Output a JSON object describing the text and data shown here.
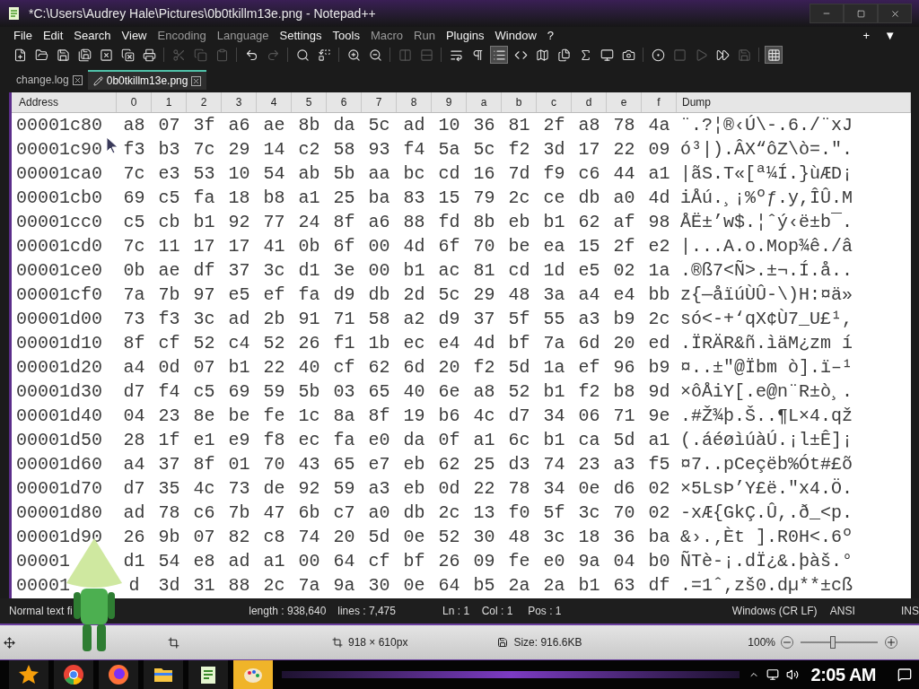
{
  "window": {
    "title": "*C:\\Users\\Audrey Hale\\Pictures\\0b0tkillm13e.png - Notepad++"
  },
  "menu": [
    {
      "label": "File",
      "disabled": false
    },
    {
      "label": "Edit",
      "disabled": false
    },
    {
      "label": "Search",
      "disabled": false
    },
    {
      "label": "View",
      "disabled": false
    },
    {
      "label": "Encoding",
      "disabled": true
    },
    {
      "label": "Language",
      "disabled": true
    },
    {
      "label": "Settings",
      "disabled": false
    },
    {
      "label": "Tools",
      "disabled": false
    },
    {
      "label": "Macro",
      "disabled": true
    },
    {
      "label": "Run",
      "disabled": true
    },
    {
      "label": "Plugins",
      "disabled": false
    },
    {
      "label": "Window",
      "disabled": false
    },
    {
      "label": "?",
      "disabled": false
    }
  ],
  "menu_right": [
    "+",
    "▼"
  ],
  "toolbar": [
    {
      "disabled": false,
      "on": false
    },
    {
      "disabled": false,
      "on": false
    },
    {
      "disabled": false,
      "on": false
    },
    {
      "disabled": false,
      "on": false
    },
    {
      "disabled": false,
      "on": false
    },
    {
      "disabled": false,
      "on": false
    },
    {
      "disabled": false,
      "on": false
    },
    {
      "disabled": true,
      "on": false
    },
    {
      "disabled": true,
      "on": false
    },
    {
      "disabled": true,
      "on": false
    },
    {
      "disabled": false,
      "on": false
    },
    {
      "disabled": true,
      "on": false
    },
    {
      "disabled": false,
      "on": false
    },
    {
      "disabled": false,
      "on": false
    },
    {
      "disabled": false,
      "on": false
    },
    {
      "disabled": false,
      "on": false
    },
    {
      "disabled": true,
      "on": false
    },
    {
      "disabled": true,
      "on": false
    },
    {
      "disabled": false,
      "on": false
    },
    {
      "disabled": false,
      "on": false
    },
    {
      "disabled": false,
      "on": true
    },
    {
      "disabled": false,
      "on": false
    },
    {
      "disabled": false,
      "on": false
    },
    {
      "disabled": false,
      "on": false
    },
    {
      "disabled": false,
      "on": false
    },
    {
      "disabled": false,
      "on": false
    },
    {
      "disabled": false,
      "on": false
    },
    {
      "disabled": false,
      "on": false
    },
    {
      "disabled": true,
      "on": false
    },
    {
      "disabled": true,
      "on": false
    },
    {
      "disabled": false,
      "on": false
    },
    {
      "disabled": true,
      "on": false
    },
    {
      "disabled": false,
      "on": true
    }
  ],
  "tabs": [
    {
      "label": "change.log",
      "selected": false,
      "modified": false
    },
    {
      "label": "0b0tkillm13e.png",
      "selected": true,
      "modified": true
    }
  ],
  "table": {
    "columns": [
      "Address",
      "0",
      "1",
      "2",
      "3",
      "4",
      "5",
      "6",
      "7",
      "8",
      "9",
      "a",
      "b",
      "c",
      "d",
      "e",
      "f",
      "Dump"
    ],
    "rows": [
      {
        "address": "00001c80",
        "bytes": [
          "a8",
          "07",
          "3f",
          "a6",
          "ae",
          "8b",
          "da",
          "5c",
          "ad",
          "10",
          "36",
          "81",
          "2f",
          "a8",
          "78",
          "4a"
        ],
        "dump": "¨.?¦®‹Ú\\-.6./¨xJ"
      },
      {
        "address": "00001c90",
        "bytes": [
          "f3",
          "b3",
          "7c",
          "29",
          "14",
          "c2",
          "58",
          "93",
          "f4",
          "5a",
          "5c",
          "f2",
          "3d",
          "17",
          "22",
          "09"
        ],
        "dump": "ó³|).ÂX“ôZ\\ò=.\"."
      },
      {
        "address": "00001ca0",
        "bytes": [
          "7c",
          "e3",
          "53",
          "10",
          "54",
          "ab",
          "5b",
          "aa",
          "bc",
          "cd",
          "16",
          "7d",
          "f9",
          "c6",
          "44",
          "a1"
        ],
        "dump": "|ãS.T«[ª¼Í.}ùÆD¡"
      },
      {
        "address": "00001cb0",
        "bytes": [
          "69",
          "c5",
          "fa",
          "18",
          "b8",
          "a1",
          "25",
          "ba",
          "83",
          "15",
          "79",
          "2c",
          "ce",
          "db",
          "a0",
          "4d"
        ],
        "dump": "iÅú.¸¡%ºƒ.y,ÎÛ.M"
      },
      {
        "address": "00001cc0",
        "bytes": [
          "c5",
          "cb",
          "b1",
          "92",
          "77",
          "24",
          "8f",
          "a6",
          "88",
          "fd",
          "8b",
          "eb",
          "b1",
          "62",
          "af",
          "98"
        ],
        "dump": "ÅË±’w$.¦ˆý‹ë±b¯."
      },
      {
        "address": "00001cd0",
        "bytes": [
          "7c",
          "11",
          "17",
          "17",
          "41",
          "0b",
          "6f",
          "00",
          "4d",
          "6f",
          "70",
          "be",
          "ea",
          "15",
          "2f",
          "e2"
        ],
        "dump": "|...A.o.Mop¾ê./â"
      },
      {
        "address": "00001ce0",
        "bytes": [
          "0b",
          "ae",
          "df",
          "37",
          "3c",
          "d1",
          "3e",
          "00",
          "b1",
          "ac",
          "81",
          "cd",
          "1d",
          "e5",
          "02",
          "1a"
        ],
        "dump": ".®ß7<Ñ>.±¬.Í.å.."
      },
      {
        "address": "00001cf0",
        "bytes": [
          "7a",
          "7b",
          "97",
          "e5",
          "ef",
          "fa",
          "d9",
          "db",
          "2d",
          "5c",
          "29",
          "48",
          "3a",
          "a4",
          "e4",
          "bb"
        ],
        "dump": "z{—åïúÙÛ-\\)H:¤ä»"
      },
      {
        "address": "00001d00",
        "bytes": [
          "73",
          "f3",
          "3c",
          "ad",
          "2b",
          "91",
          "71",
          "58",
          "a2",
          "d9",
          "37",
          "5f",
          "55",
          "a3",
          "b9",
          "2c"
        ],
        "dump": "só<-+‘qX¢Ù7_U£¹,"
      },
      {
        "address": "00001d10",
        "bytes": [
          "8f",
          "cf",
          "52",
          "c4",
          "52",
          "26",
          "f1",
          "1b",
          "ec",
          "e4",
          "4d",
          "bf",
          "7a",
          "6d",
          "20",
          "ed"
        ],
        "dump": ".ÏRÄR&ñ.ìäM¿zm í"
      },
      {
        "address": "00001d20",
        "bytes": [
          "a4",
          "0d",
          "07",
          "b1",
          "22",
          "40",
          "cf",
          "62",
          "6d",
          "20",
          "f2",
          "5d",
          "1a",
          "ef",
          "96",
          "b9"
        ],
        "dump": "¤..±\"@Ïbm ò].ï–¹"
      },
      {
        "address": "00001d30",
        "bytes": [
          "d7",
          "f4",
          "c5",
          "69",
          "59",
          "5b",
          "03",
          "65",
          "40",
          "6e",
          "a8",
          "52",
          "b1",
          "f2",
          "b8",
          "9d"
        ],
        "dump": "×ôÅiY[.e@n¨R±ò¸."
      },
      {
        "address": "00001d40",
        "bytes": [
          "04",
          "23",
          "8e",
          "be",
          "fe",
          "1c",
          "8a",
          "8f",
          "19",
          "b6",
          "4c",
          "d7",
          "34",
          "06",
          "71",
          "9e"
        ],
        "dump": ".#Ž¾þ.Š..¶L×4.qž"
      },
      {
        "address": "00001d50",
        "bytes": [
          "28",
          "1f",
          "e1",
          "e9",
          "f8",
          "ec",
          "fa",
          "e0",
          "da",
          "0f",
          "a1",
          "6c",
          "b1",
          "ca",
          "5d",
          "a1"
        ],
        "dump": "(.áéøìúàÚ.¡l±Ê]¡"
      },
      {
        "address": "00001d60",
        "bytes": [
          "a4",
          "37",
          "8f",
          "01",
          "70",
          "43",
          "65",
          "e7",
          "eb",
          "62",
          "25",
          "d3",
          "74",
          "23",
          "a3",
          "f5"
        ],
        "dump": "¤7..pCeçëb%Ót#£õ"
      },
      {
        "address": "00001d70",
        "bytes": [
          "d7",
          "35",
          "4c",
          "73",
          "de",
          "92",
          "59",
          "a3",
          "eb",
          "0d",
          "22",
          "78",
          "34",
          "0e",
          "d6",
          "02"
        ],
        "dump": "×5LsÞ’Y£ë.\"x4.Ö."
      },
      {
        "address": "00001d80",
        "bytes": [
          "ad",
          "78",
          "c6",
          "7b",
          "47",
          "6b",
          "c7",
          "a0",
          "db",
          "2c",
          "13",
          "f0",
          "5f",
          "3c",
          "70",
          "02"
        ],
        "dump": "-xÆ{GkÇ.Û,.ð_<p."
      },
      {
        "address": "00001d90",
        "bytes": [
          "26",
          "9b",
          "07",
          "82",
          "c8",
          "74",
          "20",
          "5d",
          "0e",
          "52",
          "30",
          "48",
          "3c",
          "18",
          "36",
          "ba"
        ],
        "dump": "&›.‚Èt ].R0H<.6º"
      },
      {
        "address": "00001",
        "bytes": [
          "d1",
          "54",
          "e8",
          "ad",
          "a1",
          "00",
          "64",
          "cf",
          "bf",
          "26",
          "09",
          "fe",
          "e0",
          "9a",
          "04",
          "b0"
        ],
        "dump": "ÑTè-¡.dÏ¿&.þàš.°"
      },
      {
        "address": "00001",
        "bytes": [
          "d",
          "3d",
          "31",
          "88",
          "2c",
          "7a",
          "9a",
          "30",
          "0e",
          "64",
          "b5",
          "2a",
          "2a",
          "b1",
          "63",
          "df"
        ],
        "dump": ".=1ˆ,zš0.dµ**±cß"
      }
    ]
  },
  "status_bar": {
    "type": "Normal text fi",
    "length": "length : 938,640",
    "lines": "lines : 7,475",
    "ln": "Ln : 1",
    "col": "Col : 1",
    "pos": "Pos : 1",
    "eol": "Windows (CR LF)",
    "encoding": "ANSI",
    "mode": "INS"
  },
  "viewer_bar": {
    "dimensions": "918 × 610px",
    "size": "Size: 916.6KB",
    "zoom": "100%",
    "zoom_slider": {
      "level": 0.42
    }
  },
  "taskbar": {
    "apps": [
      {
        "selected": false
      },
      {
        "selected": false
      },
      {
        "selected": false
      },
      {
        "selected": false
      },
      {
        "selected": false
      },
      {
        "selected": true
      }
    ],
    "time": "2:05 AM"
  }
}
